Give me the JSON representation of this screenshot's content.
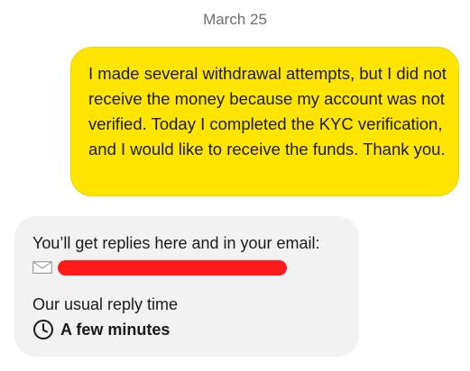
{
  "chat": {
    "date_separator": "March 25",
    "messages": [
      {
        "sender": "user",
        "text": "I made several withdrawal attempts, but I did not receive the money because my account was not verified. Today I completed the KYC verification, and I would like to receive the funds. Thank you.",
        "bubble_color": "#ffe500"
      }
    ],
    "reply_card": {
      "info_text": "You’ll get replies here and in your email:",
      "email_icon": "envelope-icon",
      "email_redaction_color": "#ff1a1a",
      "reply_time_label": "Our usual reply time",
      "reply_time_icon": "clock-icon",
      "reply_time_value": "A few minutes",
      "card_color": "#f2f2f2"
    }
  }
}
